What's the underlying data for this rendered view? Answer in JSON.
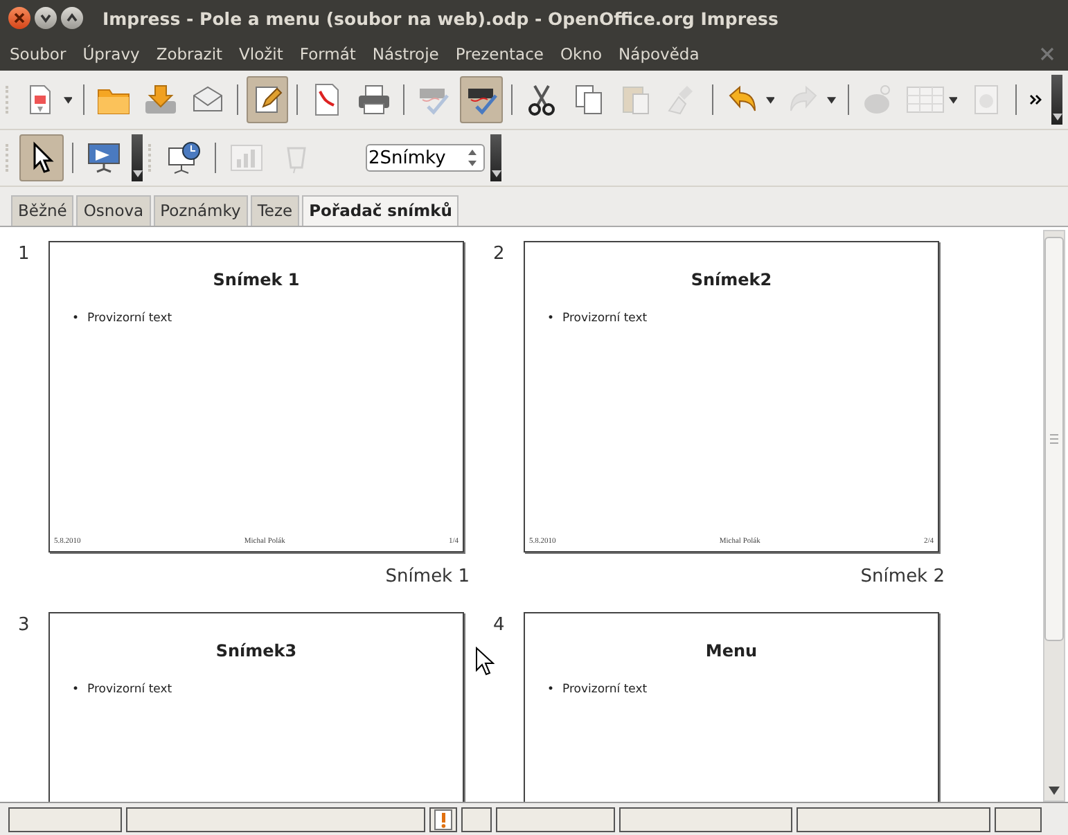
{
  "window": {
    "title": "Impress - Pole a menu (soubor na web).odp - OpenOffice.org Impress"
  },
  "menu": [
    {
      "label": "Soubor"
    },
    {
      "label": "Úpravy"
    },
    {
      "label": "Zobrazit"
    },
    {
      "label": "Vložit"
    },
    {
      "label": "Formát"
    },
    {
      "label": "Nástroje"
    },
    {
      "label": "Prezentace"
    },
    {
      "label": "Okno"
    },
    {
      "label": "Nápověda"
    }
  ],
  "toolbar": [
    {
      "kind": "new",
      "pressed": false,
      "disabled": false,
      "dropdown": true
    },
    {
      "kind": "separator"
    },
    {
      "kind": "open",
      "pressed": false,
      "disabled": false,
      "dropdown": false
    },
    {
      "kind": "save",
      "pressed": false,
      "disabled": false,
      "dropdown": false
    },
    {
      "kind": "mail",
      "pressed": false,
      "disabled": false,
      "dropdown": false
    },
    {
      "kind": "separator"
    },
    {
      "kind": "edit",
      "pressed": true,
      "disabled": false,
      "dropdown": false
    },
    {
      "kind": "separator"
    },
    {
      "kind": "pdf",
      "pressed": false,
      "disabled": false,
      "dropdown": false
    },
    {
      "kind": "print",
      "pressed": false,
      "disabled": false,
      "dropdown": false
    },
    {
      "kind": "separator"
    },
    {
      "kind": "spell",
      "pressed": false,
      "disabled": true,
      "dropdown": false
    },
    {
      "kind": "autospell",
      "pressed": true,
      "disabled": false,
      "dropdown": false
    },
    {
      "kind": "separator"
    },
    {
      "kind": "cut",
      "pressed": false,
      "disabled": false,
      "dropdown": false
    },
    {
      "kind": "copy",
      "pressed": false,
      "disabled": false,
      "dropdown": false
    },
    {
      "kind": "paste",
      "pressed": false,
      "disabled": true,
      "dropdown": false
    },
    {
      "kind": "brush",
      "pressed": false,
      "disabled": true,
      "dropdown": false
    },
    {
      "kind": "separator"
    },
    {
      "kind": "undo",
      "pressed": false,
      "disabled": false,
      "dropdown": true
    },
    {
      "kind": "redo",
      "pressed": false,
      "disabled": true,
      "dropdown": true
    },
    {
      "kind": "separator"
    },
    {
      "kind": "shapes",
      "pressed": false,
      "disabled": true,
      "dropdown": false
    },
    {
      "kind": "table",
      "pressed": false,
      "disabled": true,
      "dropdown": true
    },
    {
      "kind": "navigator",
      "pressed": false,
      "disabled": true,
      "dropdown": false
    }
  ],
  "toolbar2": [
    {
      "kind": "select",
      "pressed": true,
      "disabled": false
    },
    {
      "kind": "separator"
    },
    {
      "kind": "slideshow",
      "pressed": false,
      "disabled": false
    },
    {
      "kind": "grip"
    },
    {
      "kind": "timing",
      "pressed": false,
      "disabled": false
    },
    {
      "kind": "separator"
    },
    {
      "kind": "chart",
      "pressed": false,
      "disabled": true
    },
    {
      "kind": "transition",
      "pressed": false,
      "disabled": true
    }
  ],
  "slides_per_row": {
    "value": "2Snímky"
  },
  "tabs": [
    {
      "label": "Běžné",
      "selected": false
    },
    {
      "label": "Osnova",
      "selected": false
    },
    {
      "label": "Poznámky",
      "selected": false
    },
    {
      "label": "Teze",
      "selected": false
    },
    {
      "label": "Pořadač snímků",
      "selected": true
    }
  ],
  "slides": [
    {
      "number": "1",
      "title": "Snímek 1",
      "marker": "•",
      "bullet": "Provizorní text",
      "date": "5.8.2010",
      "author": "Michal Polák",
      "page": "1/4",
      "caption": "Snímek 1"
    },
    {
      "number": "2",
      "title": "Snímek2",
      "marker": "•",
      "bullet": "Provizorní text",
      "date": "5.8.2010",
      "author": "Michal Polák",
      "page": "2/4",
      "caption": "Snímek 2"
    },
    {
      "number": "3",
      "title": "Snímek3",
      "marker": "•",
      "bullet": "Provizorní text"
    },
    {
      "number": "4",
      "title": "Menu",
      "marker": "•",
      "bullet": "Provizorní text"
    }
  ],
  "status_bar": [
    {
      "kind": "field"
    },
    {
      "kind": "field"
    },
    {
      "kind": "alert"
    },
    {
      "kind": "field"
    },
    {
      "kind": "field"
    },
    {
      "kind": "field"
    },
    {
      "kind": "field"
    },
    {
      "kind": "field"
    }
  ]
}
